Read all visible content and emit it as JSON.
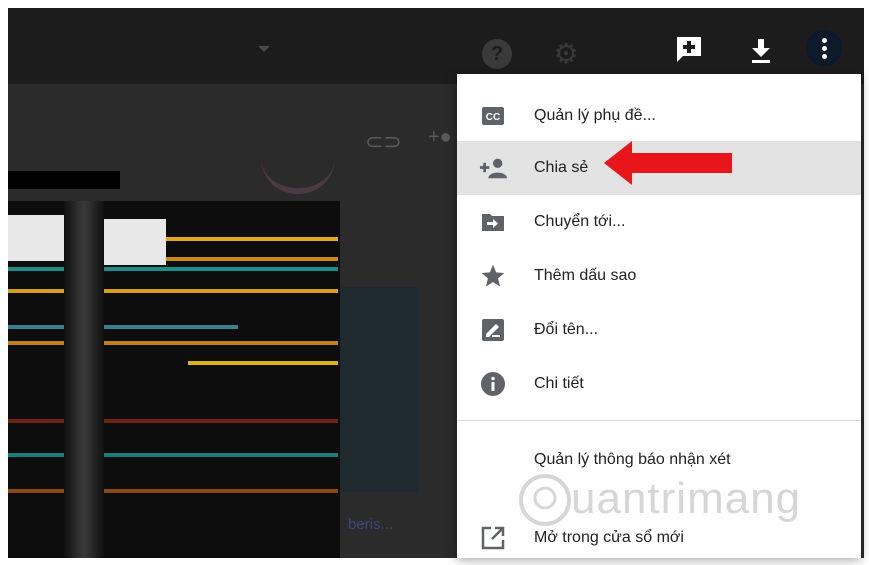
{
  "menu": {
    "items": [
      {
        "label": "Quản lý phụ đề...",
        "icon": "cc-icon",
        "selected": false
      },
      {
        "label": "Chia sẻ",
        "icon": "add-person-icon",
        "selected": true
      },
      {
        "label": "Chuyển tới...",
        "icon": "move-folder-icon",
        "selected": false
      },
      {
        "label": "Thêm dấu sao",
        "icon": "star-icon",
        "selected": false
      },
      {
        "label": "Đổi tên...",
        "icon": "rename-icon",
        "selected": false
      },
      {
        "label": "Chi tiết",
        "icon": "info-icon",
        "selected": false
      },
      {
        "label": "Quản lý thông báo nhận xét",
        "icon": "",
        "selected": false
      },
      {
        "label": "Mở trong cửa sổ mới",
        "icon": "open-new-window-icon",
        "selected": false
      }
    ]
  },
  "background": {
    "cc_text": "CC",
    "help_text": "?",
    "video_caption": "beris..."
  },
  "watermark": {
    "text": "uantrimang"
  },
  "colors": {
    "accent_red": "#e8161b",
    "menu_selected": "#e3e3e3",
    "icon_gray": "#5f6368"
  }
}
